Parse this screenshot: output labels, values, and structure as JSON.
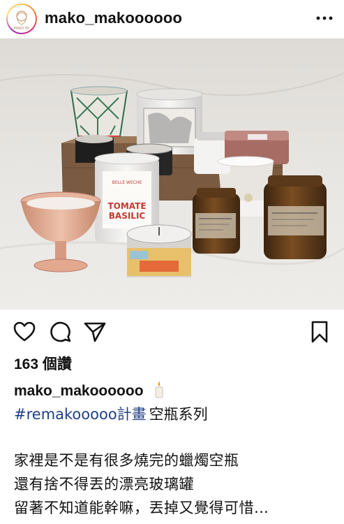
{
  "post": {
    "username": "mako_makoooooo",
    "avatar_label": "MAKO BY",
    "likes": "163 個讚",
    "caption_user": "mako_makoooooo",
    "hashtag": "#remakooooo計畫",
    "series": "空瓶系列",
    "caption_lines": [
      "家裡是不是有很多燒完的蠟燭空瓶",
      "還有捨不得丟的漂亮玻璃罐",
      "留著不知道能幹嘛，丟掉又覺得可惜…"
    ]
  },
  "photo": {
    "candle_labels": {
      "tomate_brand": "BELLE WECHE",
      "tomate_line1": "TOMATE",
      "tomate_line2": "BASILIC"
    }
  },
  "icons": {
    "like": "heart-icon",
    "comment": "comment-icon",
    "share": "share-icon",
    "save": "bookmark-icon",
    "more": "more-icon"
  },
  "colors": {
    "hashtag": "#1f3f86",
    "text": "#111111",
    "background": "#ffffff"
  }
}
